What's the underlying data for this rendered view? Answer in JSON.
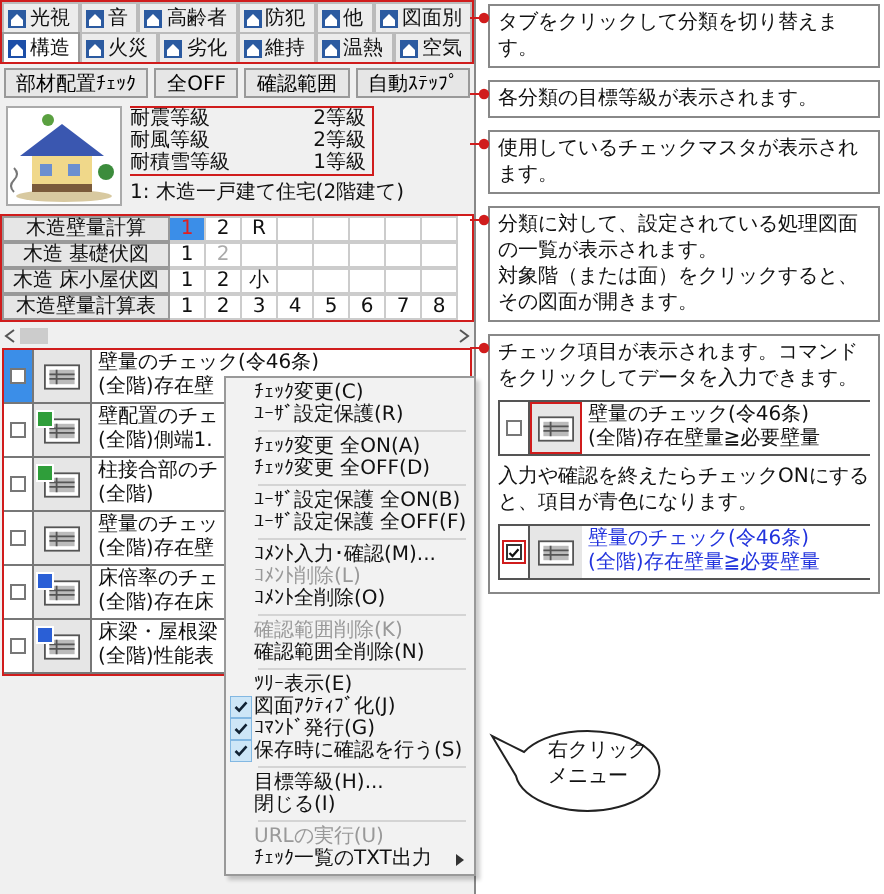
{
  "tab_rows": [
    [
      {
        "label": "光視",
        "selected": false
      },
      {
        "label": "音",
        "selected": false
      },
      {
        "label": "高齢者",
        "selected": false
      },
      {
        "label": "防犯",
        "selected": false
      },
      {
        "label": "他",
        "selected": false
      },
      {
        "label": "図面別",
        "selected": false
      }
    ],
    [
      {
        "label": "構造",
        "selected": true
      },
      {
        "label": "火災",
        "selected": false
      },
      {
        "label": "劣化",
        "selected": false
      },
      {
        "label": "維持",
        "selected": false
      },
      {
        "label": "温熱",
        "selected": false
      },
      {
        "label": "空気",
        "selected": false
      }
    ]
  ],
  "toolbar": [
    "部材配置ﾁｪｯｸ",
    "全OFF",
    "確認範囲",
    "自動ｽﾃｯﾌﾟ"
  ],
  "grades": [
    {
      "name": "耐震等級",
      "value": "2等級"
    },
    {
      "name": "耐風等級",
      "value": "2等級"
    },
    {
      "name": "耐積雪等級",
      "value": "1等級"
    }
  ],
  "check_master": "1: 木造一戸建て住宅(2階建て)",
  "drawings": [
    {
      "name": "木造壁量計算",
      "floors": [
        {
          "label": "1",
          "selected": true,
          "disabled": false
        },
        {
          "label": "2",
          "selected": false,
          "disabled": false
        },
        {
          "label": "R",
          "selected": false,
          "disabled": false
        }
      ]
    },
    {
      "name": "木造 基礎伏図",
      "floors": [
        {
          "label": "1",
          "selected": false,
          "disabled": false
        },
        {
          "label": "2",
          "selected": false,
          "disabled": true
        }
      ]
    },
    {
      "name": "木造 床小屋伏図",
      "floors": [
        {
          "label": "1",
          "selected": false,
          "disabled": false
        },
        {
          "label": "2",
          "selected": false,
          "disabled": false
        },
        {
          "label": "小",
          "selected": false,
          "disabled": false
        }
      ]
    },
    {
      "name": "木造壁量計算表",
      "floors": [
        {
          "label": "1",
          "selected": false,
          "disabled": false
        },
        {
          "label": "2",
          "selected": false,
          "disabled": false
        },
        {
          "label": "3",
          "selected": false,
          "disabled": false
        },
        {
          "label": "4",
          "selected": false,
          "disabled": false
        },
        {
          "label": "5",
          "selected": false,
          "disabled": false
        },
        {
          "label": "6",
          "selected": false,
          "disabled": false
        },
        {
          "label": "7",
          "selected": false,
          "disabled": false
        },
        {
          "label": "8",
          "selected": false,
          "disabled": false
        }
      ]
    }
  ],
  "check_items": [
    {
      "title": "壁量のチェック(令46条)",
      "detail": "(全階)存在壁",
      "checked": false,
      "selected": true
    },
    {
      "title": "壁配置のチェ",
      "detail": "(全階)側端1.",
      "checked": false,
      "selected": false,
      "color": "#2f9e3a"
    },
    {
      "title": "柱接合部のチ",
      "detail": "(全階)",
      "checked": false,
      "selected": false,
      "color": "#2f9e3a"
    },
    {
      "title": "壁量のチェッ",
      "detail": "(全階)存在壁",
      "checked": false,
      "selected": false
    },
    {
      "title": "床倍率のチェ",
      "detail": "(全階)存在床",
      "checked": false,
      "selected": false,
      "color": "#2a5fd6"
    },
    {
      "title": "床梁・屋根梁",
      "detail": "(全階)性能表",
      "checked": false,
      "selected": false,
      "color": "#2a5fd6"
    }
  ],
  "context_menu": [
    {
      "kind": "item",
      "label": "ﾁｪｯｸ変更(C)",
      "checked": false,
      "disabled": false
    },
    {
      "kind": "item",
      "label": "ﾕｰｻﾞ設定保護(R)",
      "checked": false,
      "disabled": false
    },
    {
      "kind": "separator"
    },
    {
      "kind": "item",
      "label": "ﾁｪｯｸ変更 全ON(A)",
      "checked": false,
      "disabled": false
    },
    {
      "kind": "item",
      "label": "ﾁｪｯｸ変更 全OFF(D)",
      "checked": false,
      "disabled": false
    },
    {
      "kind": "separator"
    },
    {
      "kind": "item",
      "label": "ﾕｰｻﾞ設定保護 全ON(B)",
      "checked": false,
      "disabled": false
    },
    {
      "kind": "item",
      "label": "ﾕｰｻﾞ設定保護 全OFF(F)",
      "checked": false,
      "disabled": false
    },
    {
      "kind": "separator"
    },
    {
      "kind": "item",
      "label": "ｺﾒﾝﾄ入力･確認(M)...",
      "checked": false,
      "disabled": false
    },
    {
      "kind": "item",
      "label": "ｺﾒﾝﾄ削除(L)",
      "checked": false,
      "disabled": true
    },
    {
      "kind": "item",
      "label": "ｺﾒﾝﾄ全削除(O)",
      "checked": false,
      "disabled": false
    },
    {
      "kind": "separator"
    },
    {
      "kind": "item",
      "label": "確認範囲削除(K)",
      "checked": false,
      "disabled": true
    },
    {
      "kind": "item",
      "label": "確認範囲全削除(N)",
      "checked": false,
      "disabled": false
    },
    {
      "kind": "separator"
    },
    {
      "kind": "item",
      "label": "ﾂﾘｰ表示(E)",
      "checked": false,
      "disabled": false
    },
    {
      "kind": "item",
      "label": "図面ｱｸﾃｨﾌﾞ化(J)",
      "checked": true,
      "disabled": false
    },
    {
      "kind": "item",
      "label": "ｺﾏﾝﾄﾞ発行(G)",
      "checked": true,
      "disabled": false
    },
    {
      "kind": "item",
      "label": "保存時に確認を行う(S)",
      "checked": true,
      "disabled": false
    },
    {
      "kind": "separator"
    },
    {
      "kind": "item",
      "label": "目標等級(H)...",
      "checked": false,
      "disabled": false
    },
    {
      "kind": "item",
      "label": "閉じる(I)",
      "checked": false,
      "disabled": false
    },
    {
      "kind": "separator"
    },
    {
      "kind": "item",
      "label": "URLの実行(U)",
      "checked": false,
      "disabled": true
    },
    {
      "kind": "item",
      "label": "ﾁｪｯｸ一覧のTXT出力",
      "checked": false,
      "disabled": false,
      "submenu": true
    }
  ],
  "callouts": [
    {
      "paragraphs": [
        "タブをクリックして分類を切り替えます。"
      ]
    },
    {
      "paragraphs": [
        "各分類の目標等級が表示されます。"
      ]
    },
    {
      "paragraphs": [
        "使用しているチェックマスタが表示されます。"
      ]
    },
    {
      "paragraphs": [
        "分類に対して、設定されている処理図面の一覧が表示されます。",
        "対象階（または面）をクリックすると、その図面が開きます。"
      ]
    },
    {
      "paragraphs": [
        "チェック項目が表示されます。コマンドをクリックしてデータを入力できます。"
      ],
      "examples": [
        {
          "title": "壁量のチェック(令46条)",
          "detail": "(全階)存在壁量≧必要壁量",
          "checked": false,
          "icon_highlighted": true,
          "checkbox_highlighted": false,
          "note": "入力や確認を終えたらチェックONにすると、項目が青色になります。"
        },
        {
          "title": "壁量のチェック(令46条)",
          "detail": "(全階)存在壁量≧必要壁量",
          "checked": true,
          "icon_highlighted": false,
          "checkbox_highlighted": true
        }
      ]
    }
  ],
  "bubble": {
    "lines": [
      "右クリック",
      "メニュー"
    ]
  }
}
